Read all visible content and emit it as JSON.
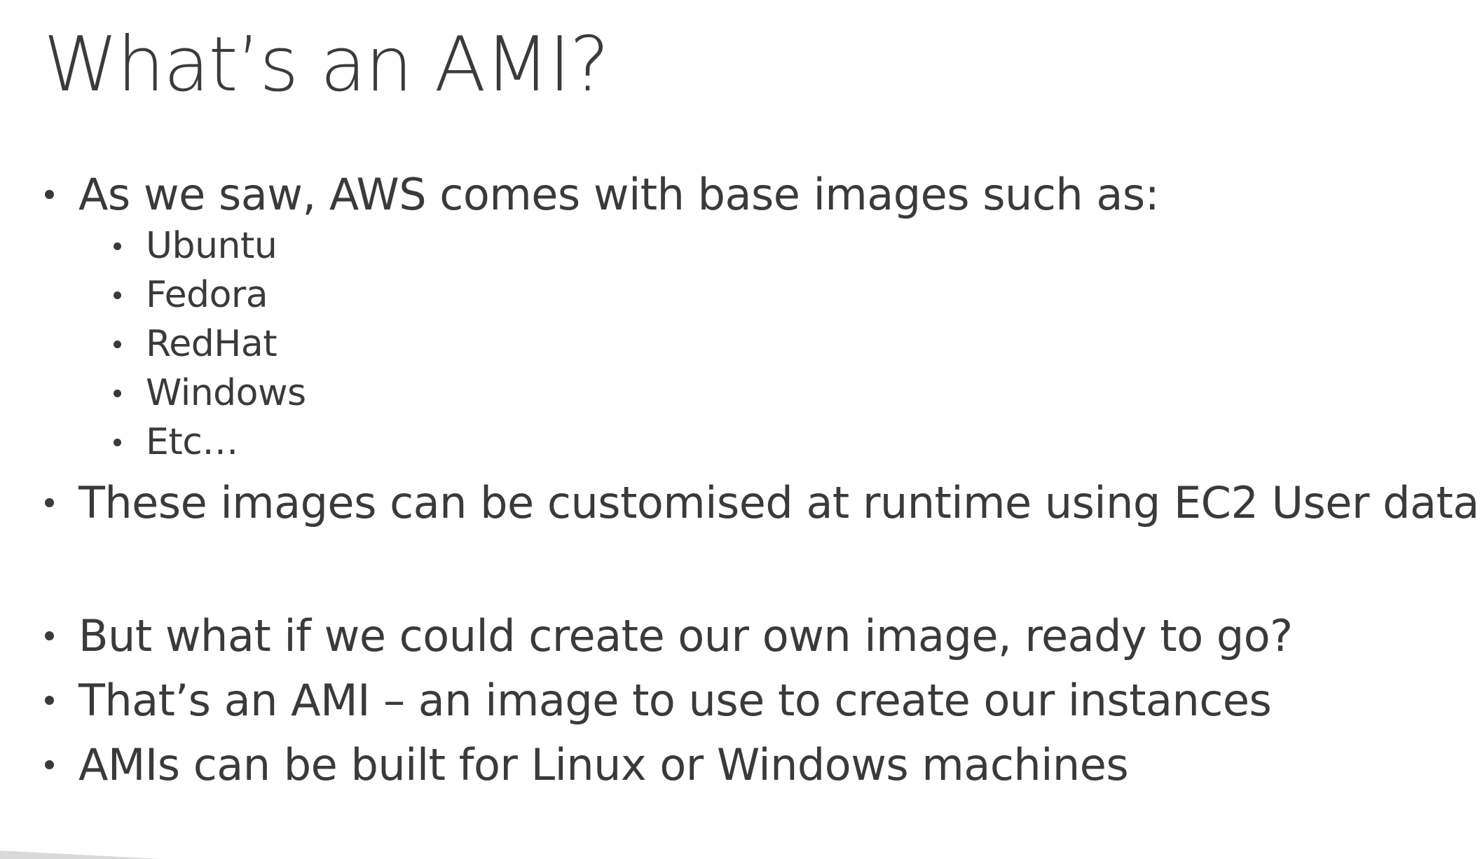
{
  "slide": {
    "title": "What’s an AMI?",
    "bullets": [
      {
        "text": "As we saw, AWS comes with base images such as:",
        "sub": [
          "Ubuntu",
          "Fedora",
          "RedHat",
          "Windows",
          "Etc…"
        ]
      },
      {
        "text": "These images can be customised at runtime using EC2 User data"
      },
      {
        "text": "But what if we could create our own image, ready to go?"
      },
      {
        "text": "That’s an AMI – an image to use to create our instances"
      },
      {
        "text": "AMIs can be built for Linux or Windows machines"
      }
    ]
  },
  "colors": {
    "text": "#3a3a3a",
    "background": "#ffffff",
    "corner_accent": "#d9d9d9"
  }
}
